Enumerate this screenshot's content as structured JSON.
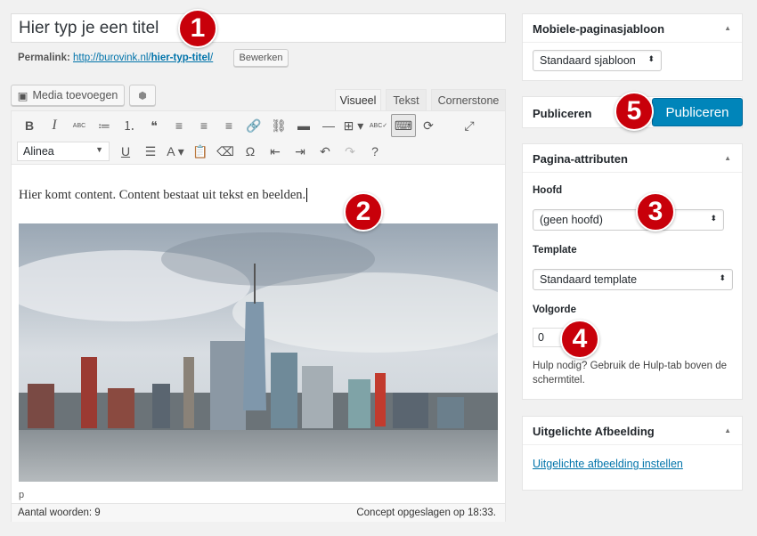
{
  "title": {
    "value": "Hier typ je een titel"
  },
  "permalink": {
    "label": "Permalink:",
    "url_base": "http://burovink.nl/",
    "slug": "hier-typ-titel",
    "trail": "/",
    "edit_button": "Bewerken"
  },
  "media": {
    "add_media": "Media toevoegen"
  },
  "tabs": [
    {
      "label": "Visueel",
      "active": true
    },
    {
      "label": "Tekst"
    },
    {
      "label": "Cornerstone"
    }
  ],
  "toolbar": {
    "row1": [
      "B",
      "I",
      "ABC",
      "≔",
      "⒈",
      "❝",
      "≡",
      "≡",
      "≡",
      "🔗",
      "⛓",
      "▬",
      "—",
      "⊞ ▾",
      "ABC✓",
      "⌨",
      "⟳",
      "⤢"
    ],
    "row1_icons": [
      "bold-icon",
      "italic-icon",
      "strikethrough-icon",
      "bullet-list-icon",
      "numbered-list-icon",
      "blockquote-icon",
      "align-left-icon",
      "align-center-icon",
      "align-right-icon",
      "link-icon",
      "unlink-icon",
      "read-more-icon",
      "horizontal-line-icon",
      "table-icon",
      "spellcheck-icon",
      "toolbar-toggle-icon",
      "refresh-icon",
      "fullscreen-icon"
    ],
    "format": "Alinea",
    "row2": [
      "U",
      "☰",
      "A ▾",
      "📋",
      "⌫",
      "Ω",
      "⇤",
      "⇥",
      "↶",
      "↷",
      "?"
    ],
    "row2_icons": [
      "underline-icon",
      "justify-icon",
      "text-color-icon",
      "paste-text-icon",
      "clear-formatting-icon",
      "special-character-icon",
      "outdent-icon",
      "indent-icon",
      "undo-icon",
      "redo-icon",
      "help-icon"
    ]
  },
  "content": {
    "text": "Hier komt content. Content bestaat uit tekst en beelden."
  },
  "statusbar": {
    "path": "p",
    "word_count": "Aantal woorden: 9",
    "saved": "Concept opgeslagen op 18:33."
  },
  "sidebar": {
    "template_box": {
      "title": "Mobiele-paginasjabloon",
      "value": "Standaard sjabloon"
    },
    "publish": {
      "title": "Publiceren",
      "button": "Publiceren"
    },
    "attributes": {
      "title": "Pagina-attributen",
      "parent_label": "Hoofd",
      "parent_value": "(geen hoofd)",
      "template_label": "Template",
      "template_value": "Standaard template",
      "order_label": "Volgorde",
      "order_value": "0",
      "help": "Hulp nodig? Gebruik de Hulp-tab boven de schermtitel."
    },
    "featured": {
      "title": "Uitgelichte Afbeelding",
      "link": "Uitgelichte afbeelding instellen"
    }
  },
  "markers": [
    "1",
    "2",
    "3",
    "4",
    "5"
  ],
  "colors": {
    "primary_button": "#0085ba",
    "link": "#0073aa",
    "marker": "#c8000a"
  }
}
